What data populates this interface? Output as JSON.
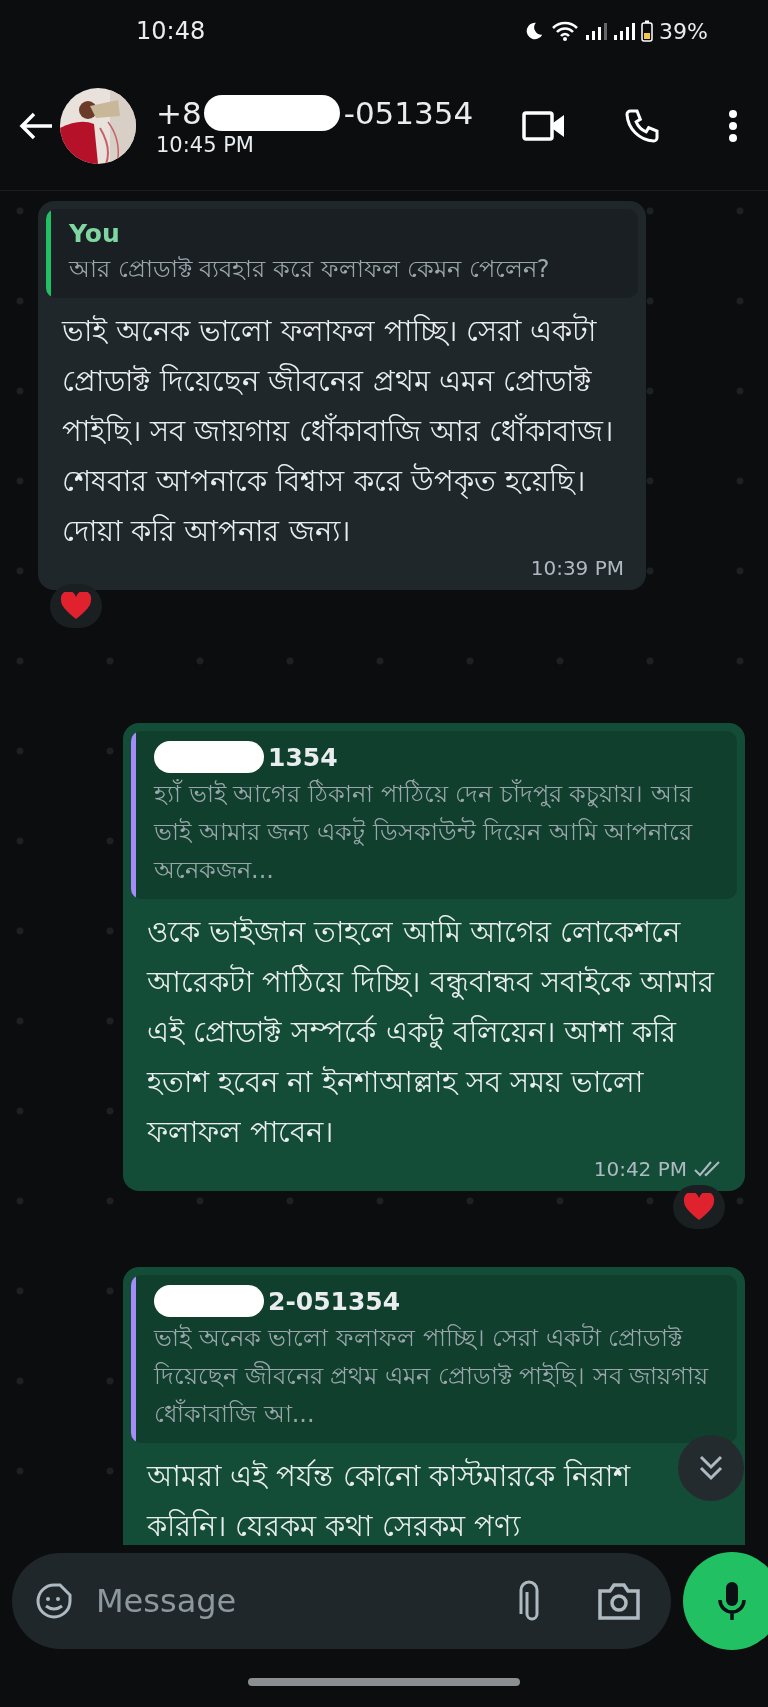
{
  "status_bar": {
    "time": "10:48",
    "battery": "39%"
  },
  "header": {
    "name_start": "+8",
    "name_end": "-051354",
    "last_seen": "10:45 PM"
  },
  "messages": [
    {
      "kind": "incoming",
      "quote": {
        "author": "You",
        "kind": "self",
        "text": "আর প্রোডাক্ট ব্যবহার করে ফলাফল কেমন পেলেন?"
      },
      "text": "ভাই অনেক ভালো ফলাফল পাচ্ছি। সেরা একটা প্রোডাক্ট দিয়েছেন জীবনের প্রথম এমন প্রোডাক্ট পাইছি। সব জায়গায় ধোঁকাবাজি আর ধোঁকাবাজ। শেষবার আপনাকে বিশ্বাস করে উপকৃত হয়েছি। দোয়া করি আপনার জন্য।",
      "time": "10:39 PM",
      "reacted": true
    },
    {
      "kind": "outgoing",
      "quote": {
        "author": "1354",
        "kind": "contact",
        "text": "হ্যাঁ ভাই আগের ঠিকানা পাঠিয়ে দেন চাঁদপুর কচুয়ায়। আর ভাই আমার জন্য একটু ডিসকাউন্ট দিয়েন আমি আপনারে অনেকজন..."
      },
      "text": "ওকে ভাইজান তাহলে আমি আগের লোকেশনে আরেকটা পাঠিয়ে দিচ্ছি। বন্ধুবান্ধব সবাইকে আমার এই প্রোডাক্ট সম্পর্কে একটু বলিয়েন। আশা করি হতাশ হবেন না ইনশাআল্লাহ সব সময় ভালো ফলাফল পাবেন।",
      "time": "10:42 PM",
      "read": false,
      "reacted": true
    },
    {
      "kind": "outgoing",
      "quote": {
        "author": "2-051354",
        "kind": "contact",
        "text": "ভাই অনেক ভালো ফলাফল পাচ্ছি। সেরা একটা প্রোডাক্ট দিয়েছেন জীবনের প্রথম এমন প্রোডাক্ট পাইছি। সব জায়গায় ধোঁকাবাজি আ..."
      },
      "text": "আমরা এই পর্যন্ত কোনো কাস্টমারকে নিরাশ করিনি। যেরকম কথা সেরকম পণ্য"
    }
  ],
  "composer": {
    "placeholder": "Message"
  }
}
